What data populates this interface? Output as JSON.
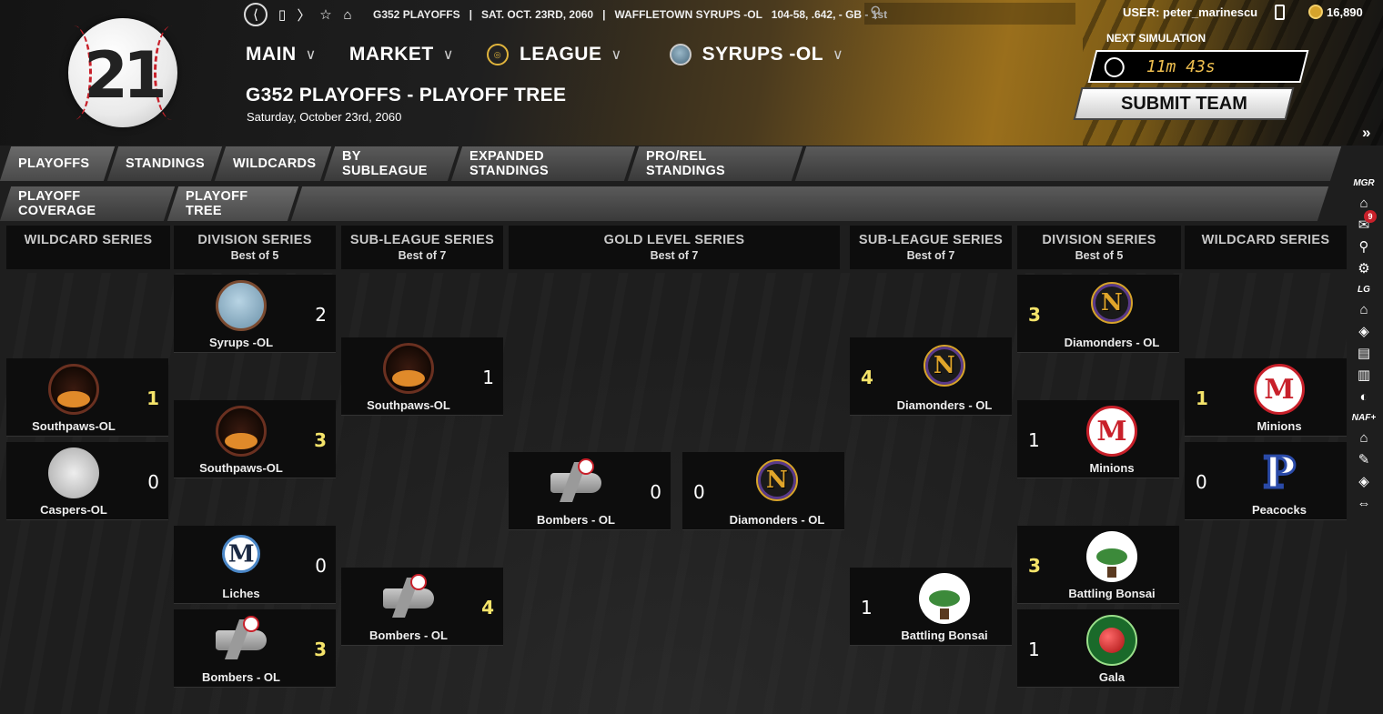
{
  "logo": {
    "number": "21"
  },
  "topbar": {
    "info": "G352 PLAYOFFS   |   SAT. OCT. 23RD, 2060   |   WAFFLETOWN SYRUPS -OL   104-58, .642, - GB - 1st",
    "user": "USER: peter_marinescu",
    "coins": "16,890"
  },
  "mainnav": [
    {
      "label": "MAIN",
      "badge": null
    },
    {
      "label": "MARKET",
      "badge": null
    },
    {
      "label": "LEAGUE",
      "badge": "league"
    },
    {
      "label": "SYRUPS -OL",
      "badge": "team"
    }
  ],
  "page": {
    "title": "G352 PLAYOFFS - PLAYOFF TREE",
    "date": "Saturday, October 23rd, 2060"
  },
  "simulation": {
    "label": "NEXT SIMULATION",
    "time": "11m 43s",
    "submit_label": "SUBMIT TEAM"
  },
  "tabs_row1": [
    "PLAYOFFS",
    "STANDINGS",
    "WILDCARDS",
    "BY SUBLEAGUE",
    "EXPANDED STANDINGS",
    "PRO/REL STANDINGS"
  ],
  "tabs_row2": [
    "PLAYOFF COVERAGE",
    "PLAYOFF TREE"
  ],
  "sidebar": {
    "mgr_label": "MGR",
    "lg_label": "LG",
    "naf_label": "NAF+",
    "mail_count": "9"
  },
  "columns": {
    "wc_left": {
      "title": "WILDCARD SERIES",
      "sub": ""
    },
    "ds_left": {
      "title": "DIVISION SERIES",
      "sub": "Best of 5"
    },
    "sls_left": {
      "title": "SUB-LEAGUE SERIES",
      "sub": "Best of 7"
    },
    "gold": {
      "title": "GOLD LEVEL SERIES",
      "sub": "Best of 7"
    },
    "sls_right": {
      "title": "SUB-LEAGUE SERIES",
      "sub": "Best of 7"
    },
    "ds_right": {
      "title": "DIVISION SERIES",
      "sub": "Best of 5"
    },
    "wc_right": {
      "title": "WILDCARD SERIES",
      "sub": ""
    }
  },
  "cards": {
    "wcl1": {
      "team": "Southpaws-OL",
      "score": "1"
    },
    "wcl2": {
      "team": "Caspers-OL",
      "score": "0"
    },
    "dsl1": {
      "team": "Syrups -OL",
      "score": "2"
    },
    "dsl2": {
      "team": "Southpaws-OL",
      "score": "3"
    },
    "dsl3": {
      "team": "Liches",
      "score": "0"
    },
    "dsl4": {
      "team": "Bombers - OL",
      "score": "3"
    },
    "slsl1": {
      "team": "Southpaws-OL",
      "score": "1"
    },
    "slsl2": {
      "team": "Bombers - OL",
      "score": "4"
    },
    "gold1": {
      "team": "Bombers - OL",
      "score": "0"
    },
    "gold2": {
      "team": "Diamonders - OL",
      "score": "0"
    },
    "slsr1": {
      "team": "Diamonders - OL",
      "score": "4"
    },
    "slsr2": {
      "team": "Battling Bonsai",
      "score": "1"
    },
    "dsr1": {
      "team": "Diamonders - OL",
      "score": "3"
    },
    "dsr2": {
      "team": "Minions",
      "score": "1"
    },
    "dsr3": {
      "team": "Battling Bonsai",
      "score": "3"
    },
    "dsr4": {
      "team": "Gala",
      "score": "1"
    },
    "wcr1": {
      "team": "Minions",
      "score": "1"
    },
    "wcr2": {
      "team": "Peacocks",
      "score": "0"
    }
  },
  "logo_letters": {
    "liches": "M",
    "diamonders": "N",
    "minions": "M",
    "peacocks": "P"
  },
  "colors": {
    "win_score": "#f5e46a",
    "accent_gold": "#d6a32b",
    "panel": "#0d0d0d"
  }
}
